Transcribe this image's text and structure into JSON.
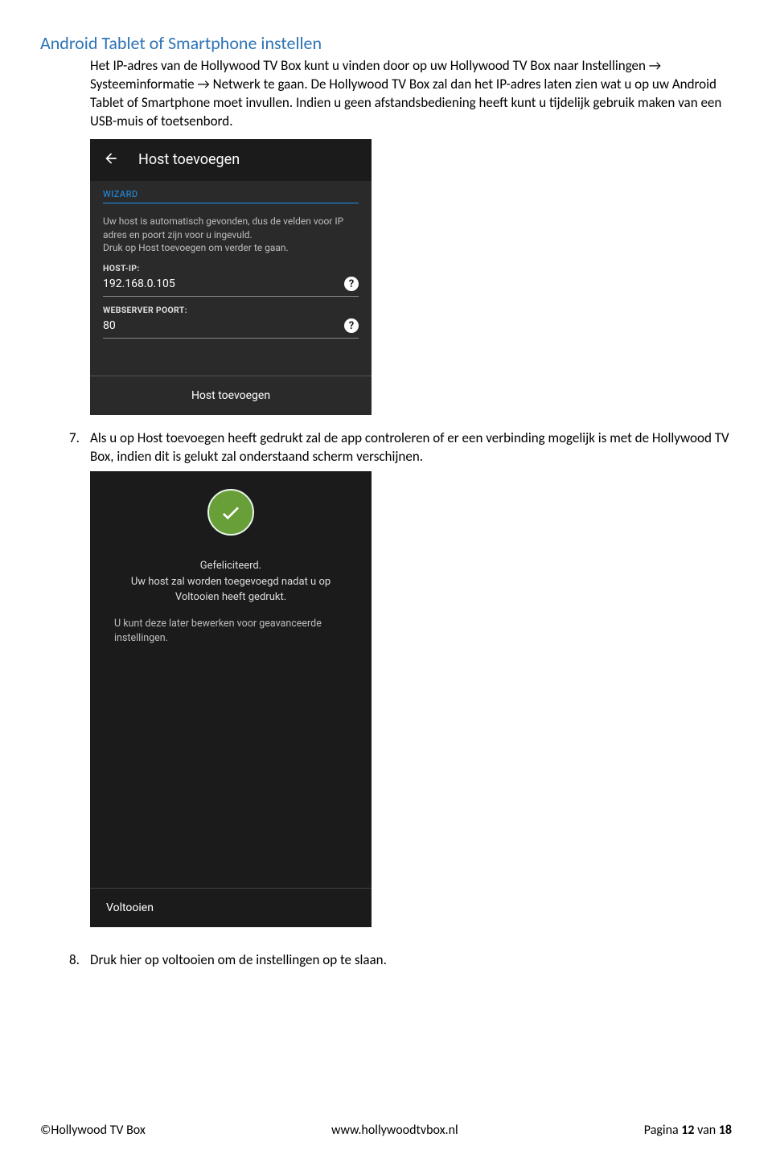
{
  "heading": "Android Tablet of Smartphone instellen",
  "intro": "Het IP-adres van de Hollywood TV Box kunt u vinden door op uw Hollywood TV Box naar Instellingen → Systeeminformatie → Netwerk te gaan. De Hollywood TV Box zal dan het IP-adres laten zien wat u op uw Android Tablet of Smartphone moet invullen. Indien u geen afstandsbediening heeft kunt u tijdelijk gebruik maken van een USB-muis of toetsenbord.",
  "screenshot1": {
    "title": "Host toevoegen",
    "wizard_label": "WIZARD",
    "help_text": "Uw host is automatisch gevonden, dus de velden voor IP adres en poort zijn voor u ingevuld.\nDruk op Host toevoegen om verder te gaan.",
    "host_ip_label": "HOST-IP:",
    "host_ip_value": "192.168.0.105",
    "port_label": "WEBSERVER POORT:",
    "port_value": "80",
    "action": "Host toevoegen"
  },
  "step7_num": "7.",
  "step7_text": "Als u op Host toevoegen heeft gedrukt zal de app controleren of er een verbinding mogelijk is met de Hollywood TV Box, indien dit is gelukt zal onderstaand scherm verschijnen.",
  "screenshot2": {
    "congrats": "Gefeliciteerd.",
    "line1": "Uw host zal worden toegevoegd nadat u op Voltooien heeft gedrukt.",
    "line2": "U kunt deze later bewerken voor geavanceerde instellingen.",
    "action": "Voltooien"
  },
  "step8_num": "8.",
  "step8_text": "Druk hier op voltooien om de instellingen op te slaan.",
  "footer": {
    "left": "©Hollywood TV Box",
    "center": "www.hollywoodtvbox.nl",
    "right_prefix": "Pagina ",
    "right_page": "12",
    "right_mid": " van ",
    "right_total": "18"
  }
}
